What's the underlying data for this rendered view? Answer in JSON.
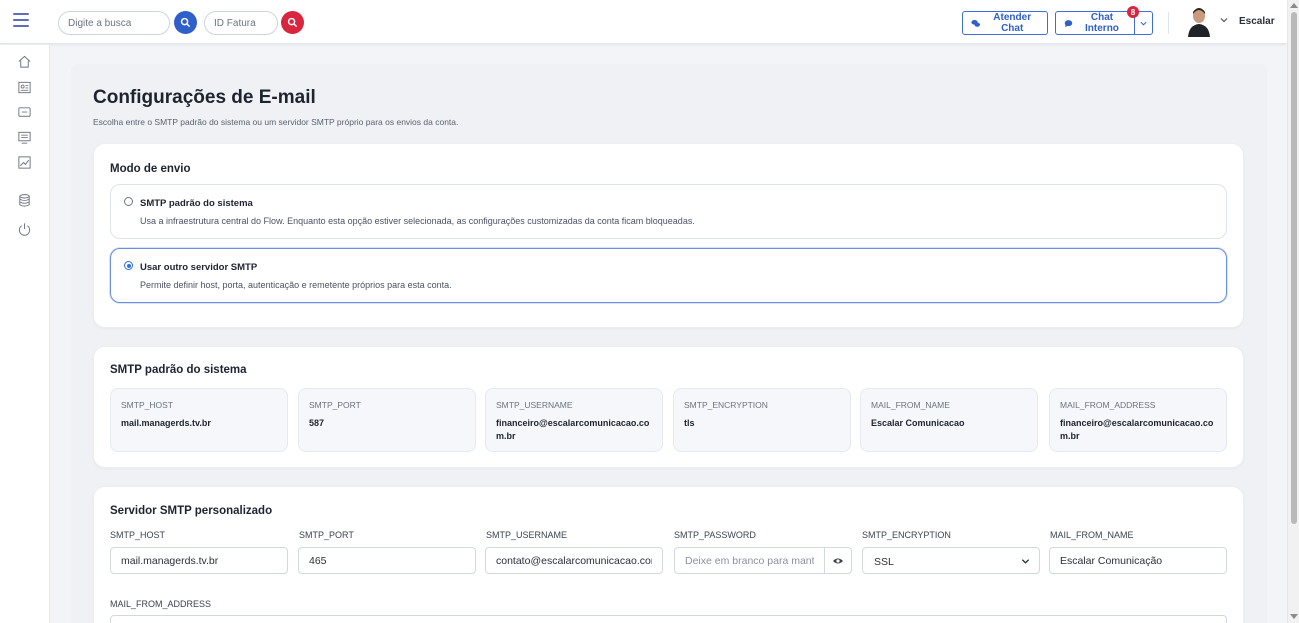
{
  "header": {
    "search_placeholder": "Digite a busca",
    "invoice_placeholder": "ID Fatura",
    "attend_chat_label": "Atender Chat",
    "internal_chat_label": "Chat Interno",
    "internal_chat_badge": "8",
    "user_name": "Escalar"
  },
  "page": {
    "title": "Configurações de E-mail",
    "subtitle": "Escolha entre o SMTP padrão do sistema ou um servidor SMTP próprio para os envios da conta."
  },
  "send_mode": {
    "title": "Modo de envio",
    "options": [
      {
        "title": "SMTP padrão do sistema",
        "description": "Usa a infraestrutura central do Flow. Enquanto esta opção estiver selecionada, as configurações customizadas da conta ficam bloqueadas.",
        "selected": false
      },
      {
        "title": "Usar outro servidor SMTP",
        "description": "Permite definir host, porta, autenticação e remetente próprios para esta conta.",
        "selected": true
      }
    ]
  },
  "system_smtp": {
    "title": "SMTP padrão do sistema",
    "items": [
      {
        "label": "SMTP_HOST",
        "value": "mail.managerds.tv.br"
      },
      {
        "label": "SMTP_PORT",
        "value": "587"
      },
      {
        "label": "SMTP_USERNAME",
        "value": "financeiro@escalarcomunicacao.com.br"
      },
      {
        "label": "SMTP_ENCRYPTION",
        "value": "tls"
      },
      {
        "label": "MAIL_FROM_NAME",
        "value": "Escalar Comunicacao"
      },
      {
        "label": "MAIL_FROM_ADDRESS",
        "value": "financeiro@escalarcomunicacao.com.br"
      }
    ]
  },
  "custom_smtp": {
    "title": "Servidor SMTP personalizado",
    "fields": {
      "host": {
        "label": "SMTP_HOST",
        "value": "mail.managerds.tv.br"
      },
      "port": {
        "label": "SMTP_PORT",
        "value": "465"
      },
      "username": {
        "label": "SMTP_USERNAME",
        "value": "contato@escalarcomunicacao.com.br"
      },
      "password": {
        "label": "SMTP_PASSWORD",
        "placeholder": "Deixe em branco para manter a senha atual"
      },
      "encryption": {
        "label": "SMTP_ENCRYPTION",
        "value": "SSL"
      },
      "from_name": {
        "label": "MAIL_FROM_NAME",
        "value": "Escalar Comunicação"
      },
      "from_address": {
        "label": "MAIL_FROM_ADDRESS"
      }
    }
  },
  "colors": {
    "primary": "#2f5fc8",
    "search_button": "#2f5fc8",
    "invoice_button": "#d7263d",
    "badge": "#d7263d"
  },
  "icons": [
    "menu-icon",
    "search-icon",
    "chat-icon",
    "home-icon",
    "id-card-icon",
    "message-icon",
    "monitor-icon",
    "chart-icon",
    "database-icon",
    "power-icon",
    "eye-icon"
  ]
}
